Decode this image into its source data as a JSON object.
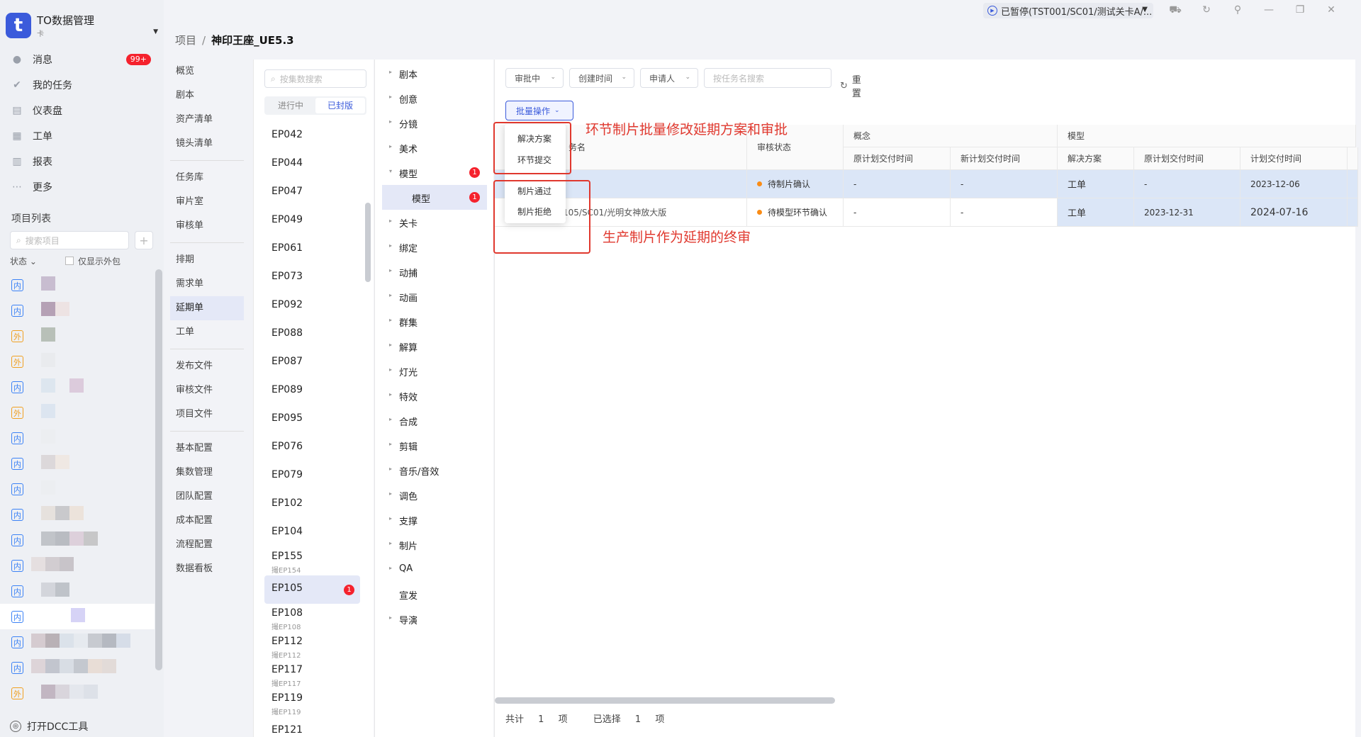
{
  "app": {
    "title": "TO数据管理",
    "subtitle": "卡",
    "logo_letter": "t"
  },
  "topbar": {
    "status": "已暂停(TST001/SC01/测试关卡A/...",
    "icons": [
      "tray-icon",
      "refresh-icon",
      "pin-icon",
      "minimize-icon",
      "restore-icon",
      "close-icon"
    ]
  },
  "nav": [
    {
      "label": "消息",
      "icon": "message-icon",
      "badge": "99+"
    },
    {
      "label": "我的任务",
      "icon": "check-icon"
    },
    {
      "label": "仪表盘",
      "icon": "dashboard-icon"
    },
    {
      "label": "工单",
      "icon": "ticket-icon"
    },
    {
      "label": "报表",
      "icon": "report-icon"
    },
    {
      "label": "更多",
      "icon": "more-icon"
    }
  ],
  "project_list": {
    "heading": "项目列表",
    "search_placeholder": "搜索项目",
    "status_filter": "状态",
    "only_outsourced": "仅显示外包",
    "tags": [
      "内",
      "内",
      "外",
      "外",
      "内",
      "外",
      "内",
      "内",
      "内",
      "内",
      "内",
      "内",
      "内",
      "内",
      "内",
      "内",
      "外"
    ]
  },
  "dcc_label": "打开DCC工具",
  "breadcrumb": {
    "root": "项目",
    "sep": "/",
    "current": "神印王座_UE5.3"
  },
  "project_menu": {
    "groups": [
      [
        "概览",
        "剧本",
        "资产清单",
        "镜头清单"
      ],
      [
        "任务库",
        "审片室",
        "审核单"
      ],
      [
        "排期",
        "需求单",
        "延期单",
        "工单"
      ],
      [
        "发布文件",
        "审核文件",
        "项目文件"
      ],
      [
        "基本配置",
        "集数管理",
        "团队配置",
        "成本配置",
        "流程配置",
        "数据看板"
      ]
    ],
    "selected": "延期单"
  },
  "episodes": {
    "search_placeholder": "按集数搜索",
    "tab_in_progress": "进行中",
    "tab_locked": "已封版",
    "items": [
      {
        "name": "EP042"
      },
      {
        "name": "EP044"
      },
      {
        "name": "EP047"
      },
      {
        "name": "EP049"
      },
      {
        "name": "EP061"
      },
      {
        "name": "EP073"
      },
      {
        "name": "EP092"
      },
      {
        "name": "EP088"
      },
      {
        "name": "EP087"
      },
      {
        "name": "EP089"
      },
      {
        "name": "EP095"
      },
      {
        "name": "EP076"
      },
      {
        "name": "EP079"
      },
      {
        "name": "EP102"
      },
      {
        "name": "EP104"
      },
      {
        "name": "EP155",
        "sub": "撮EP154"
      },
      {
        "name": "EP105",
        "badge": "1",
        "selected": true
      },
      {
        "name": "EP108",
        "sub": "撮EP108"
      },
      {
        "name": "EP112",
        "sub": "撮EP112"
      },
      {
        "name": "EP117",
        "sub": "撮EP117"
      },
      {
        "name": "EP119",
        "sub": "撮EP119"
      },
      {
        "name": "EP121"
      }
    ]
  },
  "stages": [
    {
      "name": "剧本",
      "arrow": "▸"
    },
    {
      "name": "创意",
      "arrow": "▸"
    },
    {
      "name": "分镜",
      "arrow": "▸"
    },
    {
      "name": "美术",
      "arrow": "▸"
    },
    {
      "name": "模型",
      "arrow": "▾",
      "badge": "1"
    },
    {
      "name": "模型",
      "child": true,
      "selected": true,
      "badge": "1"
    },
    {
      "name": "关卡",
      "arrow": "▸"
    },
    {
      "name": "绑定",
      "arrow": "▸"
    },
    {
      "name": "动捕",
      "arrow": "▸"
    },
    {
      "name": "动画",
      "arrow": "▸"
    },
    {
      "name": "群集",
      "arrow": "▸"
    },
    {
      "name": "解算",
      "arrow": "▸"
    },
    {
      "name": "灯光",
      "arrow": "▸"
    },
    {
      "name": "特效",
      "arrow": "▸"
    },
    {
      "name": "合成",
      "arrow": "▸"
    },
    {
      "name": "剪辑",
      "arrow": "▸"
    },
    {
      "name": "音乐/音效",
      "arrow": "▸"
    },
    {
      "name": "调色",
      "arrow": "▸"
    },
    {
      "name": "支撑",
      "arrow": "▸"
    },
    {
      "name": "制片",
      "arrow": "▸"
    },
    {
      "name": "QA",
      "arrow": "▸"
    },
    {
      "name": "宣发",
      "arrow": ""
    },
    {
      "name": "导演",
      "arrow": "▸"
    }
  ],
  "filters": {
    "status": "审批中",
    "created_time": "创建时间",
    "applicant": "申请人",
    "task_search_placeholder": "按任务名搜索",
    "reset": "重置"
  },
  "batch_button": "批量操作",
  "dropdown": [
    "解决方案",
    "环节提交",
    "制片通过",
    "制片拒绝"
  ],
  "table": {
    "headers": {
      "task_name": "务名",
      "review_status": "审核状态",
      "concept": "概念",
      "model": "模型",
      "orig_delivery": "原计划交付时间",
      "new_delivery": "新计划交付时间",
      "solution": "解决方案",
      "plan_delivery": "计划交付时间"
    },
    "rows": [
      {
        "task": "",
        "status": "待制片确认",
        "c_orig": "-",
        "c_new": "-",
        "m_sol": "工单",
        "m_orig": "-",
        "m_plan": "2023-12-06"
      },
      {
        "task": "105/SC01/光明女神放大版",
        "status": "待模型环节确认",
        "c_orig": "-",
        "c_new": "-",
        "m_sol": "工单",
        "m_orig": "2023-12-31",
        "m_plan": "2024-07-16"
      }
    ]
  },
  "footer": {
    "total_label": "共计",
    "total": "1",
    "total_unit": "项",
    "selected_label": "已选择",
    "selected": "1",
    "selected_unit": "项"
  },
  "annotations": {
    "top": "环节制片批量修改延期方案和审批",
    "bottom": "生产制片作为延期的终审"
  },
  "colors": {
    "accent": "#3b5bdb",
    "badge_red": "#f5222d",
    "annotation_red": "#e0382e",
    "status_orange": "#fa8c16",
    "row_selected": "#dbe6f7"
  }
}
